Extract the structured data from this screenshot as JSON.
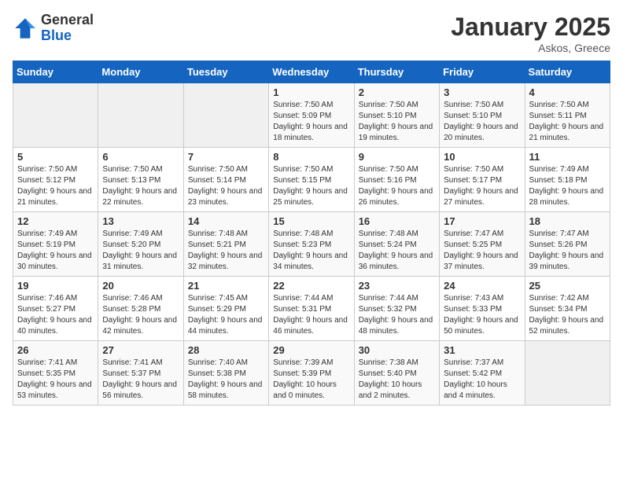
{
  "logo": {
    "general": "General",
    "blue": "Blue"
  },
  "header": {
    "month": "January 2025",
    "location": "Askos, Greece"
  },
  "weekdays": [
    "Sunday",
    "Monday",
    "Tuesday",
    "Wednesday",
    "Thursday",
    "Friday",
    "Saturday"
  ],
  "weeks": [
    [
      {
        "day": "",
        "sunrise": "",
        "sunset": "",
        "daylight": ""
      },
      {
        "day": "",
        "sunrise": "",
        "sunset": "",
        "daylight": ""
      },
      {
        "day": "",
        "sunrise": "",
        "sunset": "",
        "daylight": ""
      },
      {
        "day": "1",
        "sunrise": "Sunrise: 7:50 AM",
        "sunset": "Sunset: 5:09 PM",
        "daylight": "Daylight: 9 hours and 18 minutes."
      },
      {
        "day": "2",
        "sunrise": "Sunrise: 7:50 AM",
        "sunset": "Sunset: 5:10 PM",
        "daylight": "Daylight: 9 hours and 19 minutes."
      },
      {
        "day": "3",
        "sunrise": "Sunrise: 7:50 AM",
        "sunset": "Sunset: 5:10 PM",
        "daylight": "Daylight: 9 hours and 20 minutes."
      },
      {
        "day": "4",
        "sunrise": "Sunrise: 7:50 AM",
        "sunset": "Sunset: 5:11 PM",
        "daylight": "Daylight: 9 hours and 21 minutes."
      }
    ],
    [
      {
        "day": "5",
        "sunrise": "Sunrise: 7:50 AM",
        "sunset": "Sunset: 5:12 PM",
        "daylight": "Daylight: 9 hours and 21 minutes."
      },
      {
        "day": "6",
        "sunrise": "Sunrise: 7:50 AM",
        "sunset": "Sunset: 5:13 PM",
        "daylight": "Daylight: 9 hours and 22 minutes."
      },
      {
        "day": "7",
        "sunrise": "Sunrise: 7:50 AM",
        "sunset": "Sunset: 5:14 PM",
        "daylight": "Daylight: 9 hours and 23 minutes."
      },
      {
        "day": "8",
        "sunrise": "Sunrise: 7:50 AM",
        "sunset": "Sunset: 5:15 PM",
        "daylight": "Daylight: 9 hours and 25 minutes."
      },
      {
        "day": "9",
        "sunrise": "Sunrise: 7:50 AM",
        "sunset": "Sunset: 5:16 PM",
        "daylight": "Daylight: 9 hours and 26 minutes."
      },
      {
        "day": "10",
        "sunrise": "Sunrise: 7:50 AM",
        "sunset": "Sunset: 5:17 PM",
        "daylight": "Daylight: 9 hours and 27 minutes."
      },
      {
        "day": "11",
        "sunrise": "Sunrise: 7:49 AM",
        "sunset": "Sunset: 5:18 PM",
        "daylight": "Daylight: 9 hours and 28 minutes."
      }
    ],
    [
      {
        "day": "12",
        "sunrise": "Sunrise: 7:49 AM",
        "sunset": "Sunset: 5:19 PM",
        "daylight": "Daylight: 9 hours and 30 minutes."
      },
      {
        "day": "13",
        "sunrise": "Sunrise: 7:49 AM",
        "sunset": "Sunset: 5:20 PM",
        "daylight": "Daylight: 9 hours and 31 minutes."
      },
      {
        "day": "14",
        "sunrise": "Sunrise: 7:48 AM",
        "sunset": "Sunset: 5:21 PM",
        "daylight": "Daylight: 9 hours and 32 minutes."
      },
      {
        "day": "15",
        "sunrise": "Sunrise: 7:48 AM",
        "sunset": "Sunset: 5:23 PM",
        "daylight": "Daylight: 9 hours and 34 minutes."
      },
      {
        "day": "16",
        "sunrise": "Sunrise: 7:48 AM",
        "sunset": "Sunset: 5:24 PM",
        "daylight": "Daylight: 9 hours and 36 minutes."
      },
      {
        "day": "17",
        "sunrise": "Sunrise: 7:47 AM",
        "sunset": "Sunset: 5:25 PM",
        "daylight": "Daylight: 9 hours and 37 minutes."
      },
      {
        "day": "18",
        "sunrise": "Sunrise: 7:47 AM",
        "sunset": "Sunset: 5:26 PM",
        "daylight": "Daylight: 9 hours and 39 minutes."
      }
    ],
    [
      {
        "day": "19",
        "sunrise": "Sunrise: 7:46 AM",
        "sunset": "Sunset: 5:27 PM",
        "daylight": "Daylight: 9 hours and 40 minutes."
      },
      {
        "day": "20",
        "sunrise": "Sunrise: 7:46 AM",
        "sunset": "Sunset: 5:28 PM",
        "daylight": "Daylight: 9 hours and 42 minutes."
      },
      {
        "day": "21",
        "sunrise": "Sunrise: 7:45 AM",
        "sunset": "Sunset: 5:29 PM",
        "daylight": "Daylight: 9 hours and 44 minutes."
      },
      {
        "day": "22",
        "sunrise": "Sunrise: 7:44 AM",
        "sunset": "Sunset: 5:31 PM",
        "daylight": "Daylight: 9 hours and 46 minutes."
      },
      {
        "day": "23",
        "sunrise": "Sunrise: 7:44 AM",
        "sunset": "Sunset: 5:32 PM",
        "daylight": "Daylight: 9 hours and 48 minutes."
      },
      {
        "day": "24",
        "sunrise": "Sunrise: 7:43 AM",
        "sunset": "Sunset: 5:33 PM",
        "daylight": "Daylight: 9 hours and 50 minutes."
      },
      {
        "day": "25",
        "sunrise": "Sunrise: 7:42 AM",
        "sunset": "Sunset: 5:34 PM",
        "daylight": "Daylight: 9 hours and 52 minutes."
      }
    ],
    [
      {
        "day": "26",
        "sunrise": "Sunrise: 7:41 AM",
        "sunset": "Sunset: 5:35 PM",
        "daylight": "Daylight: 9 hours and 53 minutes."
      },
      {
        "day": "27",
        "sunrise": "Sunrise: 7:41 AM",
        "sunset": "Sunset: 5:37 PM",
        "daylight": "Daylight: 9 hours and 56 minutes."
      },
      {
        "day": "28",
        "sunrise": "Sunrise: 7:40 AM",
        "sunset": "Sunset: 5:38 PM",
        "daylight": "Daylight: 9 hours and 58 minutes."
      },
      {
        "day": "29",
        "sunrise": "Sunrise: 7:39 AM",
        "sunset": "Sunset: 5:39 PM",
        "daylight": "Daylight: 10 hours and 0 minutes."
      },
      {
        "day": "30",
        "sunrise": "Sunrise: 7:38 AM",
        "sunset": "Sunset: 5:40 PM",
        "daylight": "Daylight: 10 hours and 2 minutes."
      },
      {
        "day": "31",
        "sunrise": "Sunrise: 7:37 AM",
        "sunset": "Sunset: 5:42 PM",
        "daylight": "Daylight: 10 hours and 4 minutes."
      },
      {
        "day": "",
        "sunrise": "",
        "sunset": "",
        "daylight": ""
      }
    ]
  ]
}
